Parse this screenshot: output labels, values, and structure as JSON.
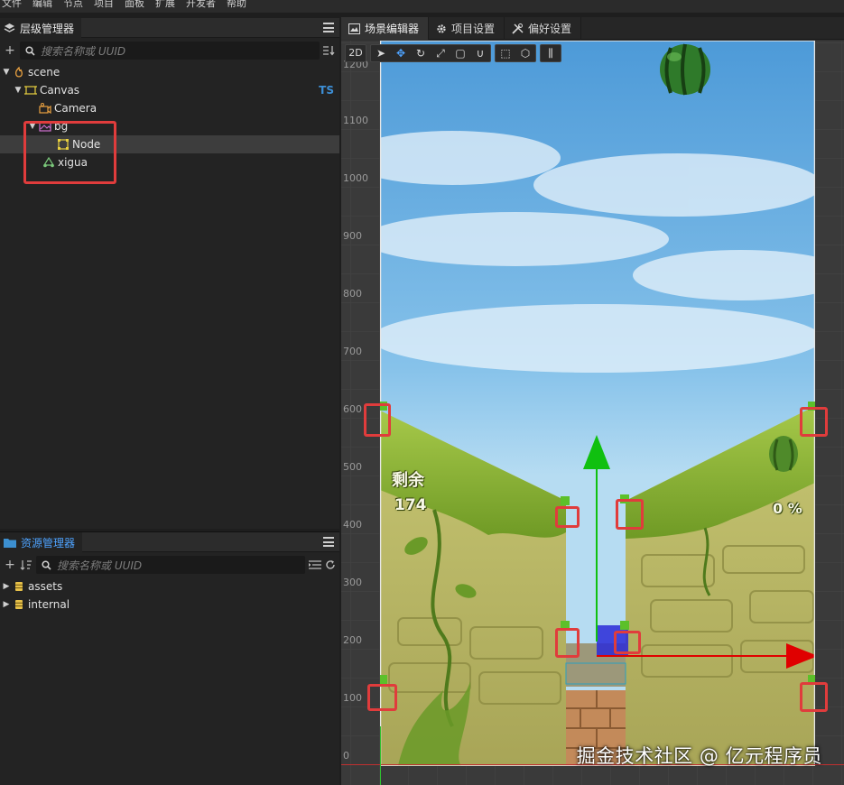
{
  "menu": [
    "文件",
    "编辑",
    "节点",
    "项目",
    "面板",
    "扩展",
    "开发者",
    "帮助"
  ],
  "hierarchy": {
    "title": "层级管理器",
    "search_placeholder": "搜索名称或 UUID",
    "ts_badge": "TS",
    "nodes": [
      {
        "label": "scene",
        "icon": "scene-icon"
      },
      {
        "label": "Canvas",
        "icon": "canvas-icon"
      },
      {
        "label": "Camera",
        "icon": "camera-icon"
      },
      {
        "label": "bg",
        "icon": "sprite-icon"
      },
      {
        "label": "Node",
        "icon": "node-icon"
      },
      {
        "label": "xigua",
        "icon": "prefab-icon"
      }
    ]
  },
  "assets": {
    "title": "资源管理器",
    "search_placeholder": "搜索名称或 UUID",
    "items": [
      {
        "label": "assets",
        "icon": "database-icon"
      },
      {
        "label": "internal",
        "icon": "database-icon"
      }
    ]
  },
  "editor": {
    "tabs": [
      "场景编辑器",
      "项目设置",
      "偏好设置"
    ],
    "mode_label": "2D",
    "y_axis_labels": [
      "1200",
      "1100",
      "1000",
      "900",
      "800",
      "700",
      "600",
      "500",
      "400",
      "300",
      "200",
      "100",
      "0"
    ]
  },
  "game": {
    "remaining_label": "剩余",
    "remaining_value": "174",
    "progress_text": "0 %"
  },
  "watermark": "掘金技术社区 @ 亿元程序员",
  "colors": {
    "selection_highlight": "#e03c3c",
    "gizmo_x": "#e00000",
    "gizmo_y": "#00c020",
    "accent": "#4ea3ff",
    "ts_badge": "#3d8fd6"
  }
}
